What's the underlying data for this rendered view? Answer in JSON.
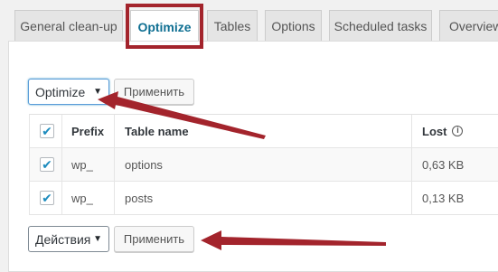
{
  "tabs": [
    {
      "label": "General clean-up"
    },
    {
      "label": "Optimize"
    },
    {
      "label": "Tables"
    },
    {
      "label": "Options"
    },
    {
      "label": "Scheduled tasks"
    },
    {
      "label": "Overview"
    }
  ],
  "active_tab": "Optimize",
  "top_action": {
    "selected": "Optimize",
    "apply_label": "Применить"
  },
  "bottom_action": {
    "selected": "Действия",
    "apply_label": "Применить"
  },
  "table": {
    "headers": {
      "prefix": "Prefix",
      "name": "Table name",
      "lost": "Lost"
    },
    "rows": [
      {
        "checked": true,
        "prefix": "wp_",
        "name": "options",
        "lost": "0,63 KB"
      },
      {
        "checked": true,
        "prefix": "wp_",
        "name": "posts",
        "lost": "0,13 KB"
      }
    ]
  },
  "colors": {
    "highlight": "#a3242c",
    "accent": "#0f6f92",
    "checkbox": "#1e8cbe"
  },
  "icons": {
    "checkmark": "✔",
    "info": "i",
    "caret": "▼"
  }
}
